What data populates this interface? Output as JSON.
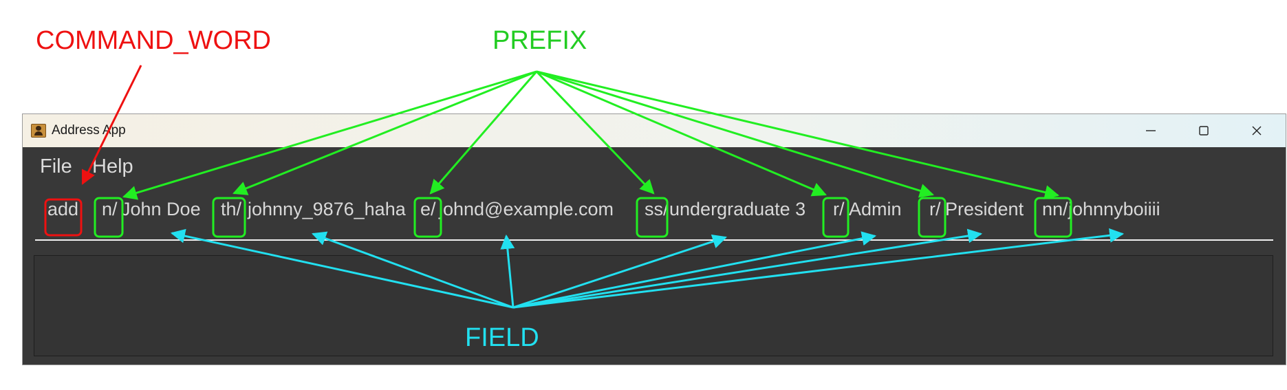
{
  "annotations": {
    "command_word": "COMMAND_WORD",
    "prefix": "PREFIX",
    "field": "FIELD"
  },
  "colors": {
    "command_word": "#ee1111",
    "prefix": "#22ee22",
    "field": "#22e0f0",
    "window_bg": "#383838"
  },
  "window": {
    "title": "Address App",
    "icon": "address-book-icon",
    "controls": [
      "minimize-icon",
      "maximize-icon",
      "close-icon"
    ]
  },
  "menu": {
    "items": [
      "File",
      "Help"
    ]
  },
  "command": {
    "word": "add",
    "tokens": [
      {
        "prefix": "n/",
        "value": "John Doe"
      },
      {
        "prefix": "th/",
        "value": "johnny_9876_haha"
      },
      {
        "prefix": "e/",
        "value": "johnd@example.com"
      },
      {
        "prefix": "ss/",
        "value": "undergraduate 3"
      },
      {
        "prefix": "r/",
        "value": "Admin"
      },
      {
        "prefix": "r/",
        "value": "President"
      },
      {
        "prefix": "nn/",
        "value": "johnnyboiiii"
      }
    ]
  }
}
